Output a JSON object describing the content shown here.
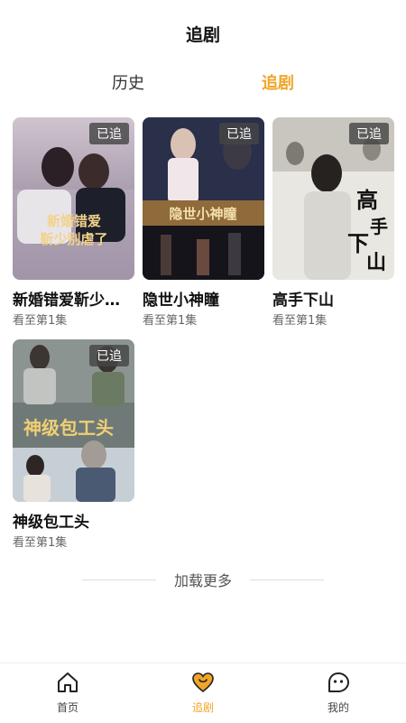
{
  "header": {
    "title": "追剧"
  },
  "tabs": [
    {
      "label": "历史"
    },
    {
      "label": "追剧"
    }
  ],
  "dramas": [
    {
      "title": "新婚错爱靳少…",
      "progress": "看至第1集",
      "badge": "已追",
      "poster_text": "新婚错爱 靳少别虐了"
    },
    {
      "title": "隐世小神瞳",
      "progress": "看至第1集",
      "badge": "已追",
      "poster_text": "隐世小神瞳"
    },
    {
      "title": "高手下山",
      "progress": "看至第1集",
      "badge": "已追",
      "poster_text": "高手下山"
    },
    {
      "title": "神级包工头",
      "progress": "看至第1集",
      "badge": "已追",
      "poster_text": "神级包工头"
    }
  ],
  "load_more": "加载更多",
  "bottom_nav": [
    {
      "label": "首页",
      "icon": "home-icon"
    },
    {
      "label": "追剧",
      "icon": "heart-icon"
    },
    {
      "label": "我的",
      "icon": "face-icon"
    }
  ],
  "colors": {
    "accent": "#f0a529"
  }
}
